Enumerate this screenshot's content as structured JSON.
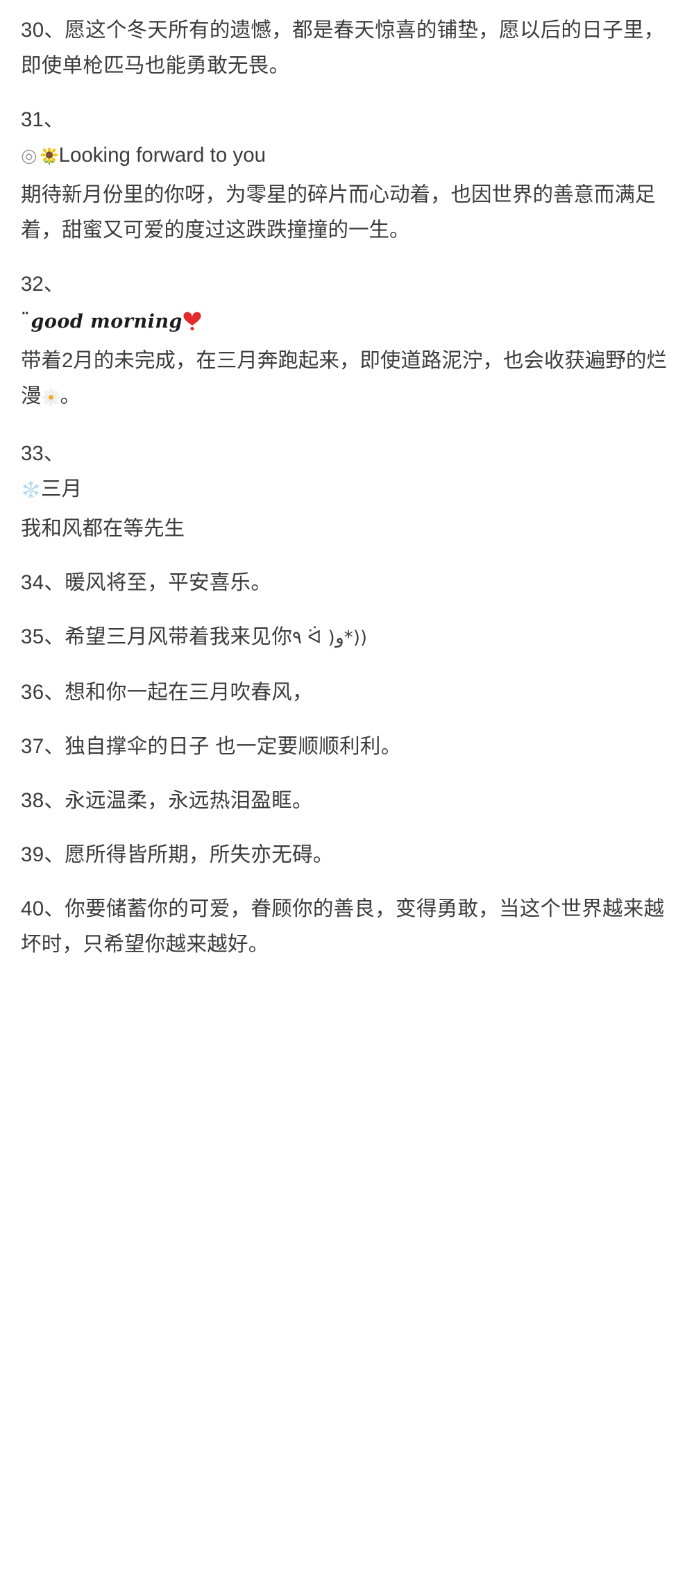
{
  "document": {
    "background_color": "#ffffff",
    "text_color": "#3c3c3c",
    "entries": [
      {
        "id": "entry-30",
        "number": "30、",
        "inline_number": true,
        "lines": [
          "30、愿这个冬天所有的遗憾，都是春天惊喜的铺垫，愿以后的日子里，即使单枪匹马也能勇敢无畏。"
        ]
      },
      {
        "id": "entry-31",
        "number": "31、",
        "inline_number": false,
        "icons": {
          "ring": "◎",
          "sunflower": "sunflower-icon"
        },
        "headline": "Looking forward to you",
        "lines": [
          "期待新月份里的你呀，为零星的碎片而心动着，也因世界的善意而满足着，甜蜜又可爱的度过这跌跌撞撞的一生。"
        ]
      },
      {
        "id": "entry-32",
        "number": "32、",
        "inline_number": false,
        "icons": {
          "smiley": "¨",
          "heart": "heart-icon"
        },
        "headline_script": "good morning",
        "lines": [
          "带着2月的未完成，在三月奔跑起来，即使道路泥泞，也会收获遍野的烂漫"
        ],
        "trailing_icon": "daisy-icon",
        "trailing_text": "。"
      },
      {
        "id": "entry-33",
        "number": "33、",
        "inline_number": false,
        "icons": {
          "snowflake": "snowflake-icon"
        },
        "headline": "三月",
        "lines": [
          "我和风都在等先生"
        ]
      },
      {
        "id": "entry-34",
        "number": "34、",
        "inline_number": true,
        "lines": [
          "34、暖风将至，平安喜乐。"
        ]
      },
      {
        "id": "entry-35",
        "number": "35、",
        "inline_number": true,
        "lines": [
          "35、希望三月风带着我来见你"
        ],
        "kaomoji": "٩ ᐛ )و*))"
      },
      {
        "id": "entry-36",
        "number": "36、",
        "inline_number": true,
        "lines": [
          "36、想和你一起在三月吹春风，"
        ]
      },
      {
        "id": "entry-37",
        "number": "37、",
        "inline_number": true,
        "lines": [
          "37、独自撑伞的日子 也一定要顺顺利利。"
        ]
      },
      {
        "id": "entry-38",
        "number": "38、",
        "inline_number": true,
        "lines": [
          "38、永远温柔，永远热泪盈眶。"
        ]
      },
      {
        "id": "entry-39",
        "number": "39、",
        "inline_number": true,
        "lines": [
          "39、愿所得皆所期，所失亦无碍。"
        ]
      },
      {
        "id": "entry-40",
        "number": "40、",
        "inline_number": true,
        "lines": [
          "40、你要储蓄你的可爱，眷顾你的善良，变得勇敢，当这个世界越来越坏时，只希望你越来越好。"
        ]
      }
    ]
  }
}
